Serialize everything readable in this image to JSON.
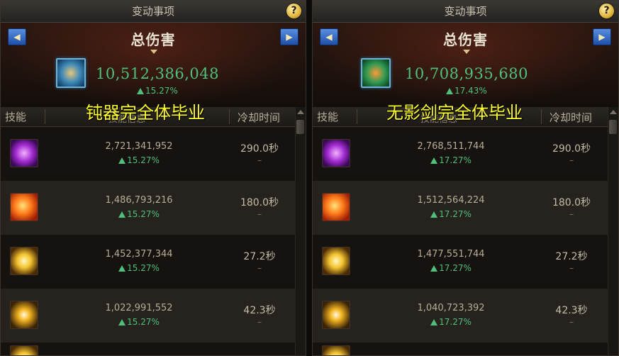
{
  "panels": [
    {
      "window_title": "变动事项",
      "help_label": "?",
      "nav_prev": "◀",
      "nav_next": "▶",
      "section_title": "总伤害",
      "total_value": "10,512,386,048",
      "total_pct": "15.27%",
      "caption": "钝器完全体毕业",
      "columns": {
        "skill": "技能",
        "info": "技能信息",
        "cooldown": "冷却时间"
      },
      "rows": [
        {
          "icon": "purple-dragon-skill-icon",
          "damage": "2,721,341,952",
          "pct": "15.27%",
          "cooldown": "290.0秒",
          "cd2": "–"
        },
        {
          "icon": "fire-beast-skill-icon",
          "damage": "1,486,793,216",
          "pct": "15.27%",
          "cooldown": "180.0秒",
          "cd2": "–"
        },
        {
          "icon": "burst-skill-icon",
          "damage": "1,452,377,344",
          "pct": "15.27%",
          "cooldown": "27.2秒",
          "cd2": "–"
        },
        {
          "icon": "starburst-skill-icon",
          "damage": "1,022,991,552",
          "pct": "15.27%",
          "cooldown": "42.3秒",
          "cd2": "–"
        }
      ]
    },
    {
      "window_title": "变动事项",
      "help_label": "?",
      "nav_prev": "◀",
      "nav_next": "▶",
      "section_title": "总伤害",
      "total_value": "10,708,935,680",
      "total_pct": "17.43%",
      "caption": "无影剑完全体毕业",
      "columns": {
        "skill": "技能",
        "info": "技能信息",
        "cooldown": "冷却时间"
      },
      "rows": [
        {
          "icon": "purple-dragon-skill-icon",
          "damage": "2,768,511,744",
          "pct": "17.27%",
          "cooldown": "290.0秒",
          "cd2": "–"
        },
        {
          "icon": "fire-beast-skill-icon",
          "damage": "1,512,564,224",
          "pct": "17.27%",
          "cooldown": "180.0秒",
          "cd2": "–"
        },
        {
          "icon": "burst-skill-icon",
          "damage": "1,477,551,744",
          "pct": "17.27%",
          "cooldown": "27.2秒",
          "cd2": "–"
        },
        {
          "icon": "starburst-skill-icon",
          "damage": "1,040,723,392",
          "pct": "17.27%",
          "cooldown": "42.3秒",
          "cd2": "–"
        }
      ]
    }
  ],
  "colors": {
    "increase_green": "#4ec07c",
    "caption_yellow": "#ffff2e",
    "nav_blue": "#1d4fa8"
  }
}
